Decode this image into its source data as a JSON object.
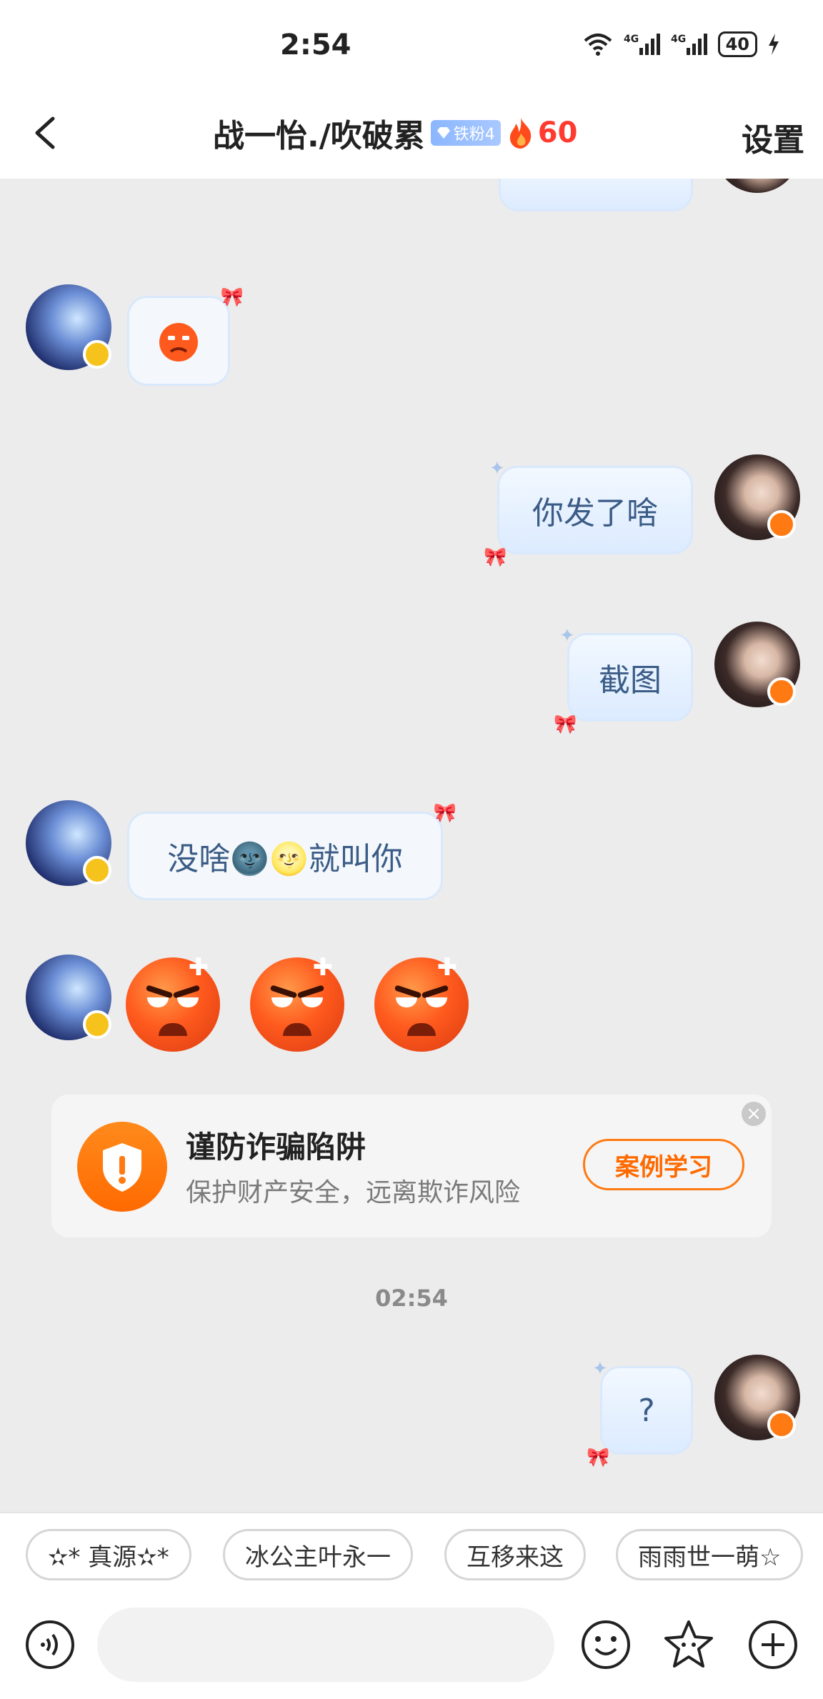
{
  "status": {
    "time": "2:54",
    "battery": "40"
  },
  "header": {
    "title": "战一怡./吹破累",
    "fan_badge": "铁粉4",
    "fire_count": "60",
    "settings": "设置"
  },
  "messages": [
    {
      "from": "me",
      "text": "你发了啥"
    },
    {
      "from": "me",
      "text": "截图"
    },
    {
      "from": "other",
      "text": "没啥🌚🌝就叫你"
    },
    {
      "from": "me",
      "text": "?"
    }
  ],
  "fraud_card": {
    "title": "谨防诈骗陷阱",
    "subtitle": "保护财产安全，远离欺诈风险",
    "button": "案例学习"
  },
  "timestamp": "02:54",
  "quick_chips": [
    "✫* 真源✫*",
    "冰公主叶永一",
    "互移来这",
    "雨雨世一萌☆"
  ],
  "colors": {
    "accent_orange": "#ff7a12",
    "fire_red": "#ff3b2f",
    "bubble_text": "#3b5c86"
  }
}
